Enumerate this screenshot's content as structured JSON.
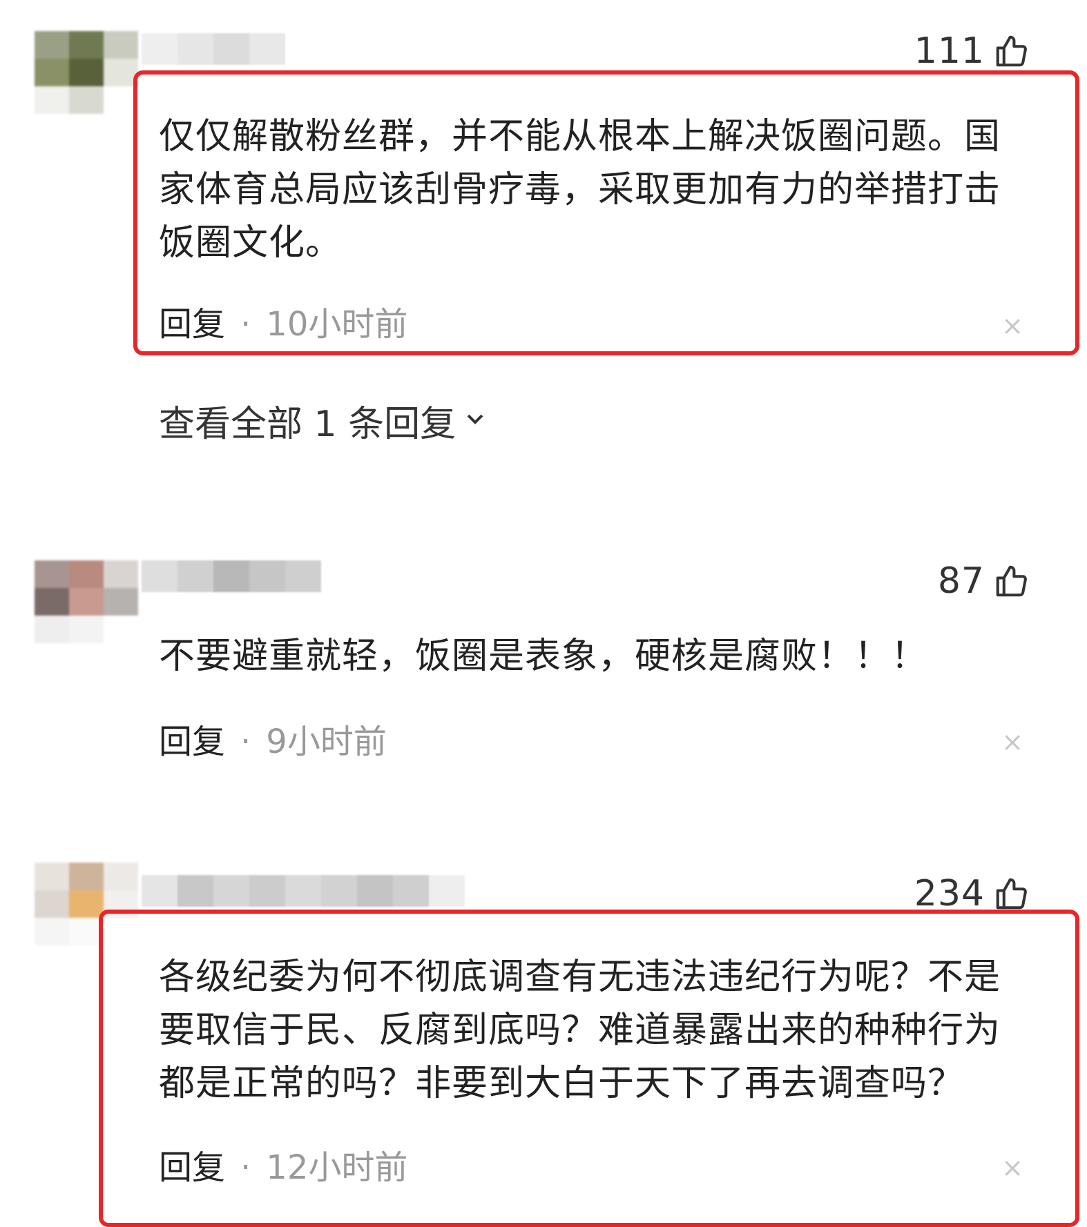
{
  "comments": [
    {
      "likes": "111",
      "text": "仅仅解散粉丝群，并不能从根本上解决饭圈问题。国家体育总局应该刮骨疗毒，采取更加有力的举措打击饭圈文化。",
      "reply_label": "回复",
      "dot": "·",
      "time": "10小时前",
      "close": "×",
      "view_replies": "查看全部 1 条回复"
    },
    {
      "likes": "87",
      "text": "不要避重就轻，饭圈是表象，硬核是腐败！！！",
      "reply_label": "回复",
      "dot": "·",
      "time": "9小时前",
      "close": "×"
    },
    {
      "likes": "234",
      "text": "各级纪委为何不彻底调查有无违法违纪行为呢？不是要取信于民、反腐到底吗？难道暴露出来的种种行为都是正常的吗？非要到大白于天下了再去调查吗？",
      "reply_label": "回复",
      "dot": "·",
      "time": "12小时前",
      "close": "×"
    }
  ],
  "colors": {
    "highlight_border": "#e8262a",
    "meta_gray": "#999999",
    "text": "#222222"
  },
  "icons": {
    "like": "thumbs-up-icon",
    "expand": "chevron-down-icon",
    "close": "close-icon"
  }
}
